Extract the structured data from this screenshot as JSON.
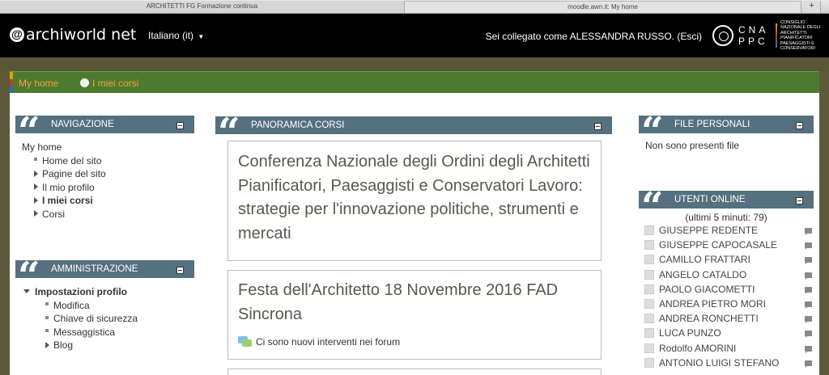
{
  "browser": {
    "tabs": [
      {
        "title": "ARCHITETTI FG Formazione continua"
      },
      {
        "title": "moodle.awn.it: My home"
      }
    ],
    "new_tab_label": "+"
  },
  "header": {
    "logo_text": "archiworld net",
    "language": "Italiano (it)",
    "login_info": "Sei collegato come ALESSANDRA RUSSO. (Esci)",
    "cnappc": {
      "letters_line1": "CNA",
      "letters_line2": "PPC",
      "description": "Consiglio Nazionale degli Architetti Pianificatori Paesaggisti e Conservatori"
    }
  },
  "breadcrumb": {
    "items": [
      "My home",
      "I miei corsi"
    ]
  },
  "navigation": {
    "title": "NAVIGAZIONE",
    "root": "My home",
    "items": [
      {
        "label": "Home del sito",
        "bullet": "dot"
      },
      {
        "label": "Pagine del sito",
        "bullet": "triangle"
      },
      {
        "label": "Il mio profilo",
        "bullet": "triangle"
      },
      {
        "label": "I miei corsi",
        "bullet": "triangle",
        "bold": true
      },
      {
        "label": "Corsi",
        "bullet": "triangle"
      }
    ]
  },
  "administration": {
    "title": "AMMINISTRAZIONE",
    "section": "Impostazioni profilo",
    "items": [
      {
        "label": "Modifica",
        "bullet": "dot"
      },
      {
        "label": "Chiave di sicurezza",
        "bullet": "dot"
      },
      {
        "label": "Messaggistica",
        "bullet": "dot"
      },
      {
        "label": "Blog",
        "bullet": "triangle"
      }
    ]
  },
  "courses": {
    "title": "PANORAMICA CORSI",
    "list": [
      {
        "name": "Conferenza Nazionale degli Ordini degli Architetti Pianificatori, Paesaggisti e Conservatori Lavoro: strategie per l'innovazione politiche, strumenti e mercati"
      },
      {
        "name": "Festa dell'Architetto 18 Novembre 2016 FAD Sincrona",
        "note": "Ci sono nuovi interventi nei forum"
      }
    ]
  },
  "private_files": {
    "title": "FILE PERSONALI",
    "text": "Non sono presenti file"
  },
  "online_users": {
    "title": "UTENTI ONLINE",
    "count_text": "(ultimi 5 minuti: 79)",
    "users": [
      "GIUSEPPE REDENTE",
      "GIUSEPPE CAPOCASALE",
      "CAMILLO FRATTARI",
      "ANGELO CATALDO",
      "PAOLO GIACOMETTI",
      "ANDREA PIETRO MORI",
      "ANDREA RONCHETTI",
      "LUCA PUNZO",
      "Rodolfo AMORINI",
      "ANTONIO LUIGI STEFANO"
    ]
  },
  "colors": {
    "header_bg": "#000000",
    "nav_green": "#4e7a2f",
    "crumb_orange": "#f2a23a",
    "block_head": "#55707f",
    "olive": "#5a5737"
  }
}
